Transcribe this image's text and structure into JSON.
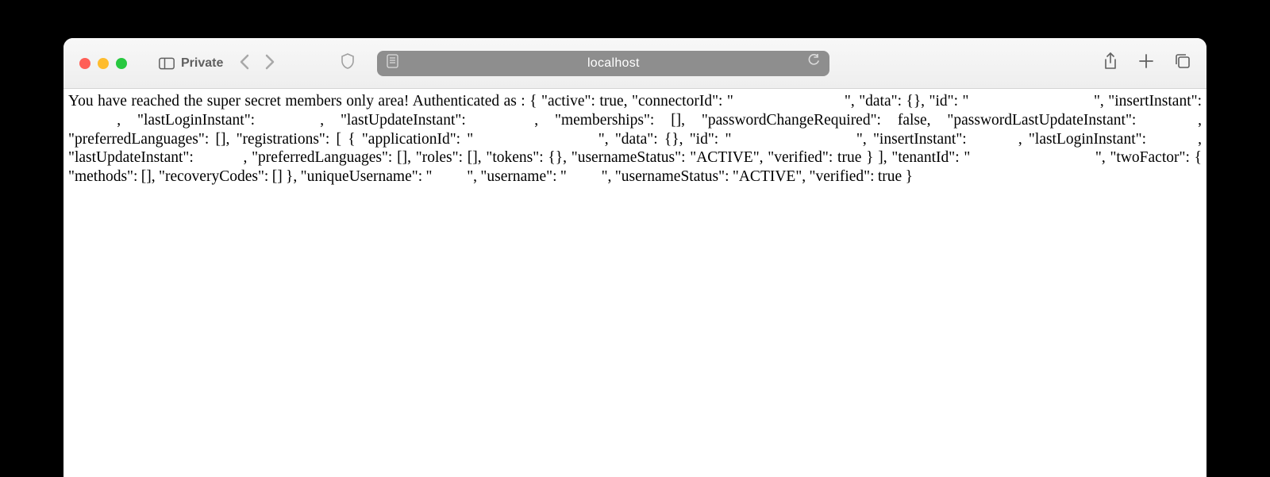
{
  "toolbar": {
    "private_label": "Private",
    "address": "localhost"
  },
  "content": {
    "prefix": "You have reached the super secret members only area! Authenticated as : ",
    "json_display": "{ \"active\": true, \"connectorId\": \"████████████████████████████████\", \"data\": {}, \"id\": \"████████████████████████████████████\", \"insertInstant\": ██████████████, \"lastLoginInstant\": ██████████████, \"lastUpdateInstant\": ███████████████, \"memberships\": [], \"passwordChangeRequired\": false, \"passwordLastUpdateInstant\": █████████████, \"preferredLanguages\": [], \"registrations\": [ { \"applicationId\": \"████████████████████████████████████\", \"data\": {}, \"id\": \"████████████████████████████████████\", \"insertInstant\": █████████████, \"lastLoginInstant\": █████████████, \"lastUpdateInstant\": █████████████, \"preferredLanguages\": [], \"roles\": [], \"tokens\": {}, \"usernameStatus\": \"ACTIVE\", \"verified\": true } ], \"tenantId\": \"████████████████████████████████████\", \"twoFactor\": { \"methods\": [], \"recoveryCodes\": [] }, \"uniqueUsername\": \"██████████\", \"username\": \"██████████\", \"usernameStatus\": \"ACTIVE\", \"verified\": true }"
  }
}
